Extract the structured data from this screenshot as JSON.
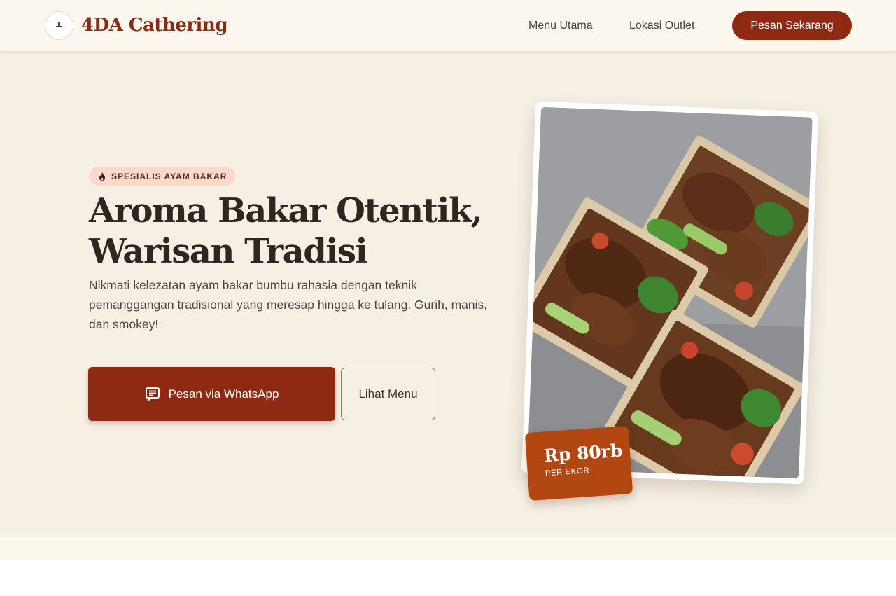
{
  "brand": {
    "name": "4DA Cathering"
  },
  "nav": {
    "links": [
      "Menu Utama",
      "Lokasi Outlet"
    ],
    "cta": "Pesan Sekarang"
  },
  "hero": {
    "badge": "SPESIALIS AYAM BAKAR",
    "title_line1": "Aroma Bakar Otentik,",
    "title_line2": "Warisan Tradisi",
    "description": "Nikmati kelezatan ayam bakar bumbu rahasia dengan teknik pemanggangan tradisional yang meresap hingga ke tulang. Gurih, manis, dan smokey!",
    "primary_button": "Pesan via WhatsApp",
    "secondary_button": "Lihat Menu"
  },
  "price": {
    "value": "Rp 80rb",
    "unit": "PER EKOR"
  },
  "colors": {
    "brand_red": "#8f2a12",
    "price_orange": "#b34712",
    "hero_bg": "#f6f0e4",
    "badge_bg": "#f9d9cb"
  },
  "icons": {
    "badge": "flame-icon",
    "primary_button": "chat-icon"
  }
}
